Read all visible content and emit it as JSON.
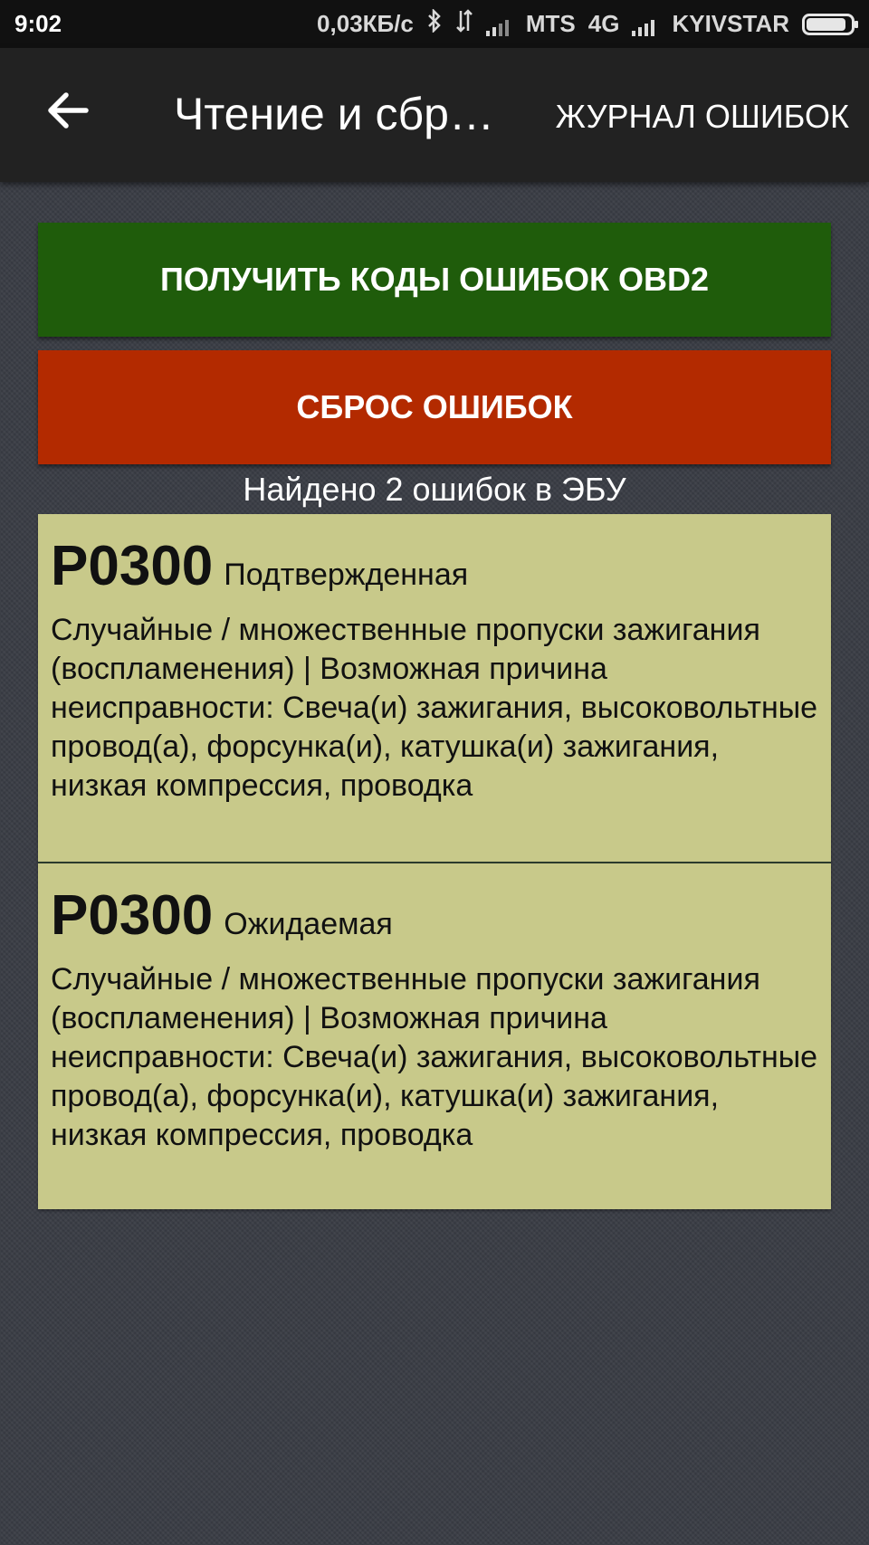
{
  "status_bar": {
    "time": "9:02",
    "speed": "0,03КБ/с",
    "carrier1": "MTS",
    "network1": "4G",
    "carrier2": "KYIVSTAR",
    "battery_level": 0.9
  },
  "toolbar": {
    "back_icon": "arrow-left-icon",
    "title": "Чтение и сбр…",
    "action_label": "ЖУРНАЛ ОШИБОК"
  },
  "buttons": {
    "read_label": "ПОЛУЧИТЬ КОДЫ ОШИБОК OBD2",
    "reset_label": "СБРОС ОШИБОК",
    "read_color": "#1f5c0b",
    "reset_color": "#b32a00"
  },
  "found_text": "Найдено 2 ошибок в ЭБУ",
  "errors": [
    {
      "code": "P0300",
      "status": "Подтвержденная",
      "description": "Случайные / множественные пропуски зажигания (воспламенения) | Возможная причина неисправности: Свеча(и) зажигания, высоковольтные провод(а), форсунка(и), катушка(и) зажигания, низкая компрессия, проводка"
    },
    {
      "code": "P0300",
      "status": "Ожидаемая",
      "description": "Случайные / множественные пропуски зажигания (воспламенения) | Возможная причина неисправности: Свеча(и) зажигания, высоковольтные провод(а), форсунка(и), катушка(и) зажигания, низкая компрессия, проводка"
    }
  ]
}
